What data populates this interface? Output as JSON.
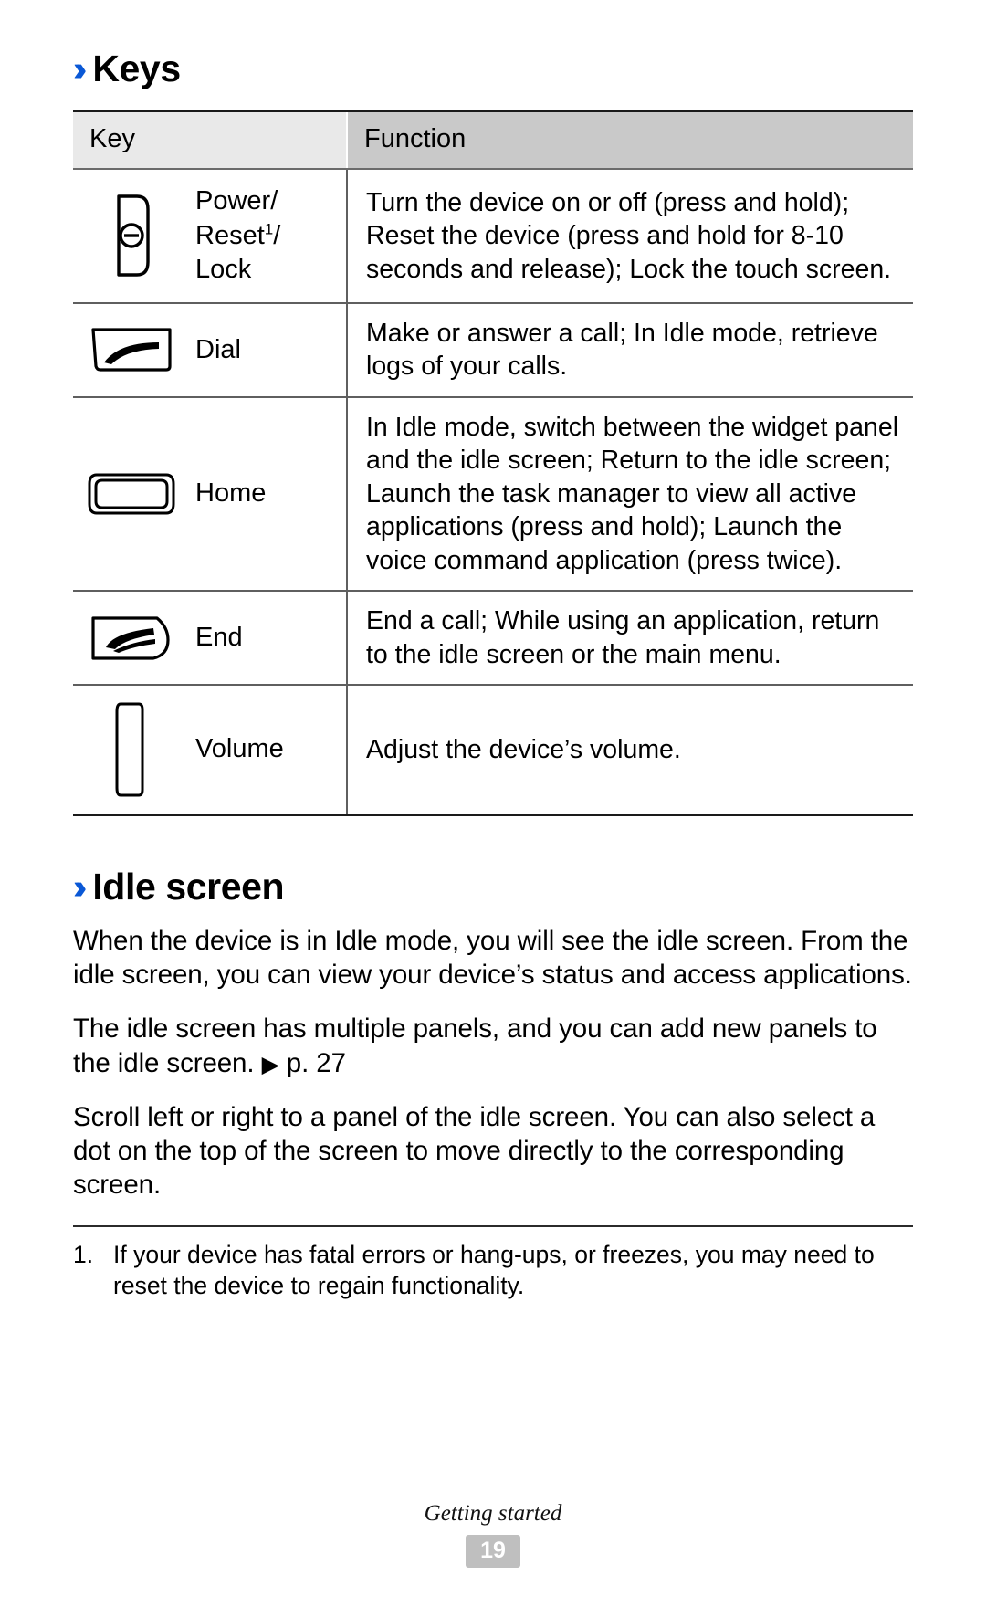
{
  "sections": {
    "keys": {
      "chevron": "››",
      "title": "Keys"
    },
    "idle": {
      "chevron": "››",
      "title": "Idle screen"
    }
  },
  "table": {
    "headers": {
      "key": "Key",
      "function": "Function"
    },
    "rows": [
      {
        "icon": "power-key-icon",
        "label_html": "Power/ Reset1/ Lock",
        "label_lines": [
          "Power/",
          "Reset",
          "Lock"
        ],
        "label_superscript": "1",
        "function": "Turn the device on or off (press and hold); Reset the device (press and hold for 8-10 seconds and release); Lock the touch screen."
      },
      {
        "icon": "dial-key-icon",
        "label": "Dial",
        "function": "Make or answer a call; In Idle mode, retrieve logs of your calls."
      },
      {
        "icon": "home-key-icon",
        "label": "Home",
        "function": "In Idle mode, switch between the widget panel and the idle screen; Return to the idle screen; Launch the task manager to view all active applications (press and hold); Launch the voice command application (press twice)."
      },
      {
        "icon": "end-key-icon",
        "label": "End",
        "function": "End a call; While using an application, return to the idle screen or the main menu."
      },
      {
        "icon": "volume-key-icon",
        "label": "Volume",
        "function": "Adjust the device’s volume."
      }
    ]
  },
  "idle_paragraphs": {
    "p1": "When the device is in Idle mode, you will see the idle screen. From the idle screen, you can view your device’s status and access applications.",
    "p2_before": "The idle screen has multiple panels, and you can add new panels to the idle screen. ",
    "p2_marker": "▶",
    "p2_ref": " p. 27",
    "p3": "Scroll left or right to a panel of the idle screen. You can also select a dot on the top of the screen to move directly to the corresponding screen."
  },
  "footnote": {
    "number": "1.",
    "text": "If your device has fatal errors or hang-ups, or freezes, you may need to reset the device to regain functionality."
  },
  "footer": {
    "chapter": "Getting started",
    "page_number": "19"
  },
  "colors": {
    "chevron_blue": "#0a58d6",
    "header_key_bg": "#e9e9e9",
    "header_function_bg": "#c9c9c9",
    "page_badge_bg": "#bfbfbf",
    "rule": "#5f5f5f"
  }
}
